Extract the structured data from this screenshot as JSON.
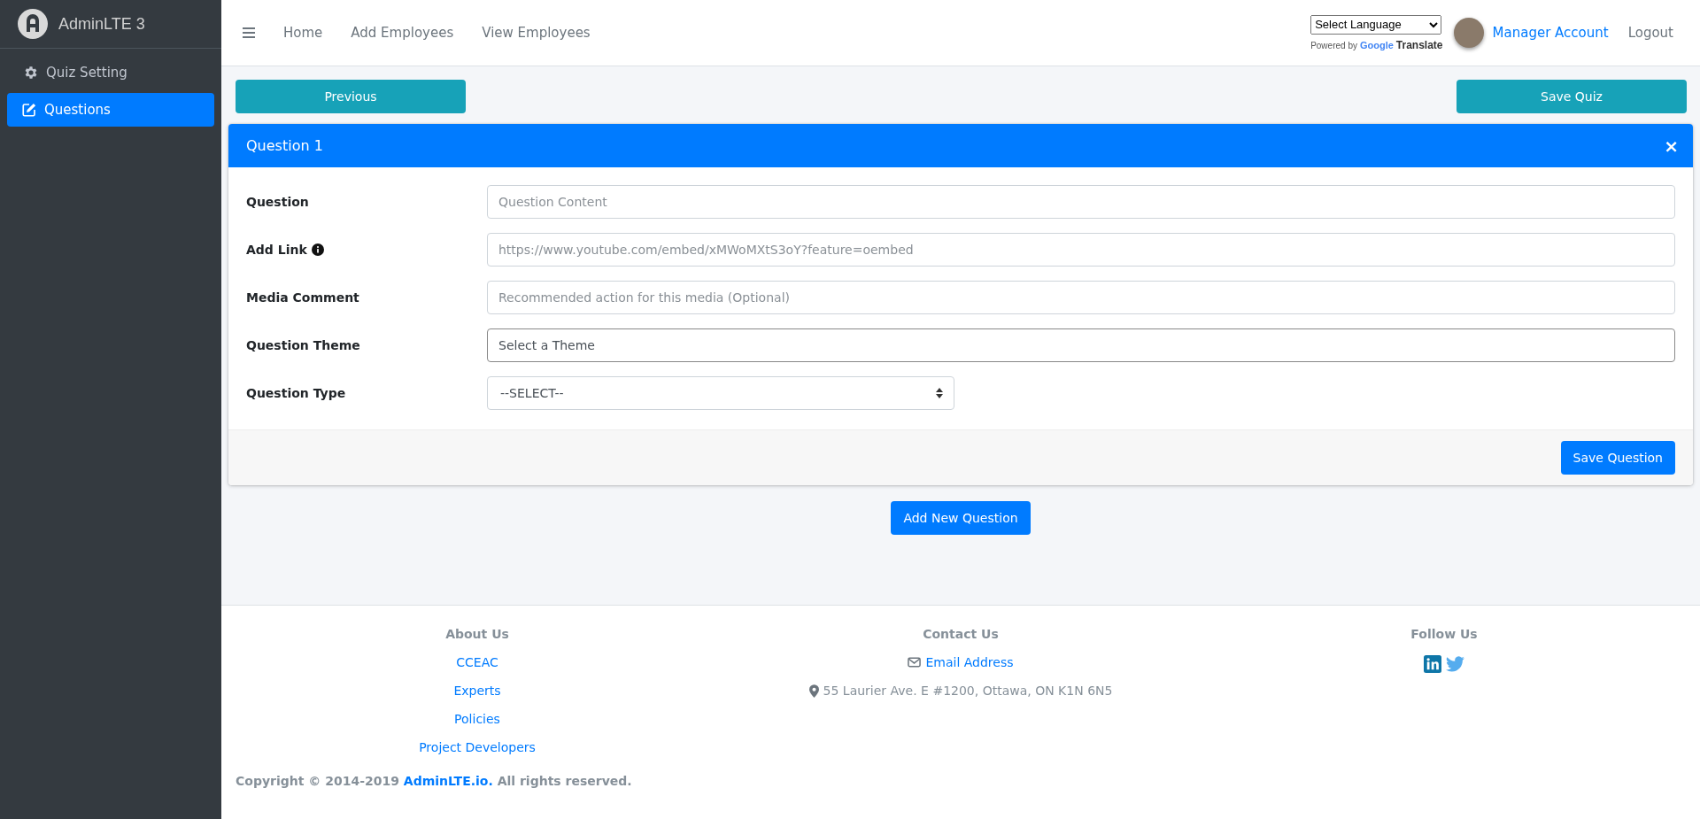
{
  "sidebar": {
    "brand": "AdminLTE 3",
    "items": [
      {
        "label": "Quiz Setting",
        "selected": false
      },
      {
        "label": "Questions",
        "selected": true
      }
    ]
  },
  "topbar": {
    "links": [
      "Home",
      "Add Employees",
      "View Employees"
    ],
    "language_select": "Select Language",
    "powered_by": "Powered by",
    "google": "Google",
    "translate": "Translate",
    "account": "Manager Account",
    "logout": "Logout"
  },
  "actions": {
    "previous": "Previous",
    "save_quiz": "Save Quiz"
  },
  "question_card": {
    "title": "Question 1",
    "close": "×",
    "fields": [
      {
        "label": "Question",
        "kind": "input",
        "placeholder": "Question Content",
        "info": false
      },
      {
        "label": "Add Link",
        "kind": "input",
        "placeholder": "https://www.youtube.com/embed/xMWoMXtS3oY?feature=oembed",
        "info": true
      },
      {
        "label": "Media Comment",
        "kind": "input",
        "placeholder": "Recommended action for this media (Optional)",
        "info": false
      },
      {
        "label": "Question Theme",
        "kind": "theme",
        "placeholder": "Select a Theme",
        "info": false
      },
      {
        "label": "Question Type",
        "kind": "select",
        "value": "--SELECT--",
        "info": false
      }
    ],
    "save": "Save Question"
  },
  "add_question": "Add New Question",
  "footer": {
    "about": {
      "heading": "About Us",
      "links": [
        "CCEAC",
        "Experts",
        "Policies",
        "Project Developers"
      ]
    },
    "contact": {
      "heading": "Contact Us",
      "email": "Email Address",
      "address": "55 Laurier Ave. E #1200, Ottawa, ON K1N 6N5"
    },
    "follow": {
      "heading": "Follow Us"
    },
    "copyright": {
      "before": "Copyright © 2014-2019",
      "link": "AdminLTE.io.",
      "after": "All rights reserved."
    }
  }
}
